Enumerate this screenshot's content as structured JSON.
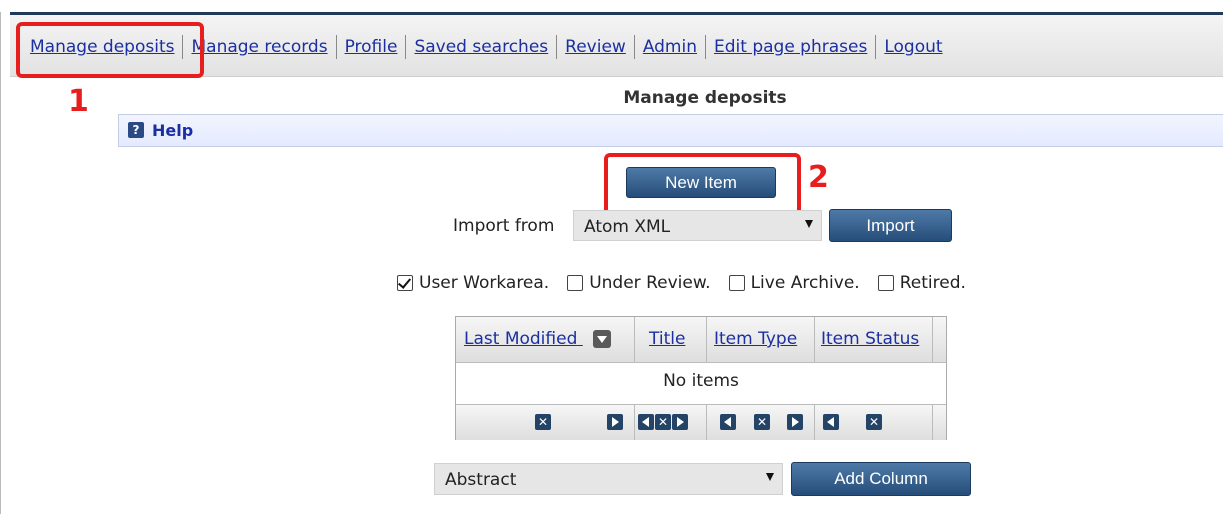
{
  "nav": {
    "items": [
      {
        "label": "Manage deposits"
      },
      {
        "label": "Manage records"
      },
      {
        "label": "Profile"
      },
      {
        "label": "Saved searches"
      },
      {
        "label": "Review"
      },
      {
        "label": "Admin"
      },
      {
        "label": "Edit page phrases"
      },
      {
        "label": "Logout"
      }
    ]
  },
  "annotations": {
    "marker1": "1",
    "marker2": "2",
    "color": "#e81e1e"
  },
  "page": {
    "title": "Manage deposits"
  },
  "help": {
    "label": "Help",
    "icon": "help-icon"
  },
  "actions": {
    "new_item_label": "New Item",
    "import_from_label": "Import from",
    "import_format": "Atom XML",
    "import_button": "Import"
  },
  "filters": [
    {
      "label": "User Workarea.",
      "checked": true
    },
    {
      "label": "Under Review.",
      "checked": false
    },
    {
      "label": "Live Archive.",
      "checked": false
    },
    {
      "label": "Retired.",
      "checked": false
    }
  ],
  "table": {
    "columns": [
      "Last Modified",
      "Title",
      "Item Type",
      "Item Status"
    ],
    "empty_text": "No items"
  },
  "add_column": {
    "selected": "Abstract",
    "button": "Add Column"
  },
  "colors": {
    "accent": "#1b2fa0",
    "button": "#264d7a",
    "topbar": "#203a5a"
  }
}
